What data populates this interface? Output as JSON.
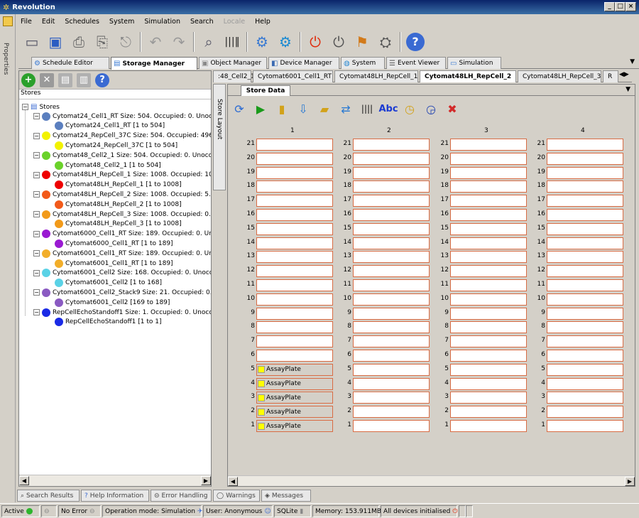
{
  "window": {
    "title": "Revolution",
    "controls": [
      "_",
      "□",
      "×"
    ]
  },
  "menu": [
    "File",
    "Edit",
    "Schedules",
    "System",
    "Simulation",
    "Search",
    "Locale",
    "Help"
  ],
  "menu_disabled": [
    "Locale"
  ],
  "toolbar": [
    "save-icon",
    "save-as-icon",
    "print-icon",
    "print-preview-icon",
    "export-icon",
    "undo-icon",
    "redo-icon",
    "find-icon",
    "barcode-icon",
    "settings-icon",
    "run-icon",
    "power-red-icon",
    "power-off-icon",
    "device-icon",
    "camera-icon",
    "help-icon"
  ],
  "sidebar": {
    "label": "Properties"
  },
  "main_tabs": [
    {
      "label": "Schedule Editor",
      "icon": "gear-icon"
    },
    {
      "label": "Storage Manager",
      "icon": "database-icon",
      "active": true
    },
    {
      "label": "Object Manager",
      "icon": "box-icon"
    },
    {
      "label": "Device Manager",
      "icon": "device-icon"
    },
    {
      "label": "System",
      "icon": "globe-icon"
    },
    {
      "label": "Event Viewer",
      "icon": "list-icon"
    },
    {
      "label": "Simulation",
      "icon": "monitor-icon"
    }
  ],
  "left": {
    "stores_label": "Stores",
    "tree_root": "Stores",
    "stores": [
      {
        "name": "Cytomat24_Cell1_RT Size: 504. Occupied: 0. Unocc",
        "child": "Cytomat24_Cell1_RT [1 to 504]",
        "color": "#5b7fbf"
      },
      {
        "name": "Cytomat24_RepCell_37C Size: 504. Occupied: 496. U",
        "child": "Cytomat24_RepCell_37C [1 to 504]",
        "color": "#f2f200"
      },
      {
        "name": "Cytomat48_Cell2_1 Size: 504. Occupied: 0. Unoccup",
        "child": "Cytomat48_Cell2_1 [1 to 504]",
        "color": "#6ad22a"
      },
      {
        "name": "Cytomat48LH_RepCell_1 Size: 1008. Occupied: 1008",
        "child": "Cytomat48LH_RepCell_1 [1 to 1008]",
        "color": "#ee0000"
      },
      {
        "name": "Cytomat48LH_RepCell_2 Size: 1008. Occupied: 5. U",
        "child": "Cytomat48LH_RepCell_2 [1 to 1008]",
        "color": "#f25a1a"
      },
      {
        "name": "Cytomat48LH_RepCell_3 Size: 1008. Occupied: 0. U",
        "child": "Cytomat48LH_RepCell_3 [1 to 1008]",
        "color": "#f29a1a"
      },
      {
        "name": "Cytomat6000_Cell1_RT Size: 189. Occupied: 0. Unoc",
        "child": "Cytomat6000_Cell1_RT [1 to 189]",
        "color": "#9a1ad2"
      },
      {
        "name": "Cytomat6001_Cell1_RT Size: 189. Occupied: 0. Unoc",
        "child": "Cytomat6001_Cell1_RT [1 to 189]",
        "color": "#f2ae2a"
      },
      {
        "name": "Cytomat6001_Cell2 Size: 168. Occupied: 0. Unoccup",
        "child": "Cytomat6001_Cell2 [1 to 168]",
        "color": "#5ad2e6"
      },
      {
        "name": "Cytomat6001_Cell2_Stack9 Size: 21. Occupied: 0. U",
        "child": "Cytomat6001_Cell2 [169 to 189]",
        "color": "#8a5ac2"
      },
      {
        "name": "RepCellEchoStandoff1 Size: 1. Occupied: 0. Unoccu",
        "child": "RepCellEchoStandoff1 [1 to 1]",
        "color": "#1a2ae6"
      }
    ]
  },
  "right": {
    "sub_tabs": [
      {
        "label": ":48_Cell2_1"
      },
      {
        "label": "Cytomat6001_Cell1_RT"
      },
      {
        "label": "Cytomat48LH_RepCell_1"
      },
      {
        "label": "Cytomat48LH_RepCell_2",
        "active": true
      },
      {
        "label": "Cytomat48LH_RepCell_3"
      },
      {
        "label": "R"
      }
    ],
    "store_layout_label": "Store Layout",
    "store_data_tab": "Store Data",
    "sd_toolbar": [
      "refresh-icon",
      "play-icon",
      "database-icon",
      "import-icon",
      "export-db-icon",
      "transfer-icon",
      "barcode-icon",
      "text-abc-icon",
      "clock-icon",
      "clock-blue-icon",
      "device-remove-icon"
    ],
    "columns": [
      "1",
      "2",
      "3",
      "4"
    ],
    "rows": [
      "21",
      "20",
      "19",
      "18",
      "17",
      "16",
      "15",
      "14",
      "13",
      "12",
      "11",
      "10",
      "9",
      "8",
      "7",
      "6",
      "5",
      "4",
      "3",
      "2",
      "1"
    ],
    "occupied_label": "AssayPlate",
    "occupied_rows": [
      "5",
      "4",
      "3",
      "2",
      "1"
    ]
  },
  "bottom_tabs": [
    {
      "label": "Search Results",
      "icon": "search-icon"
    },
    {
      "label": "Help Information",
      "icon": "help-icon"
    },
    {
      "label": "Error Handling",
      "icon": "error-icon"
    },
    {
      "label": "Warnings",
      "icon": "warning-icon"
    },
    {
      "label": "Messages",
      "icon": "messages-icon"
    }
  ],
  "status": {
    "active": "Active",
    "error": "No Error",
    "mode": "Operation mode: Simulation",
    "user": "User: Anonymous",
    "db": "SQLite",
    "memory": "Memory: 153.911MB",
    "devices": "All devices initialised"
  }
}
